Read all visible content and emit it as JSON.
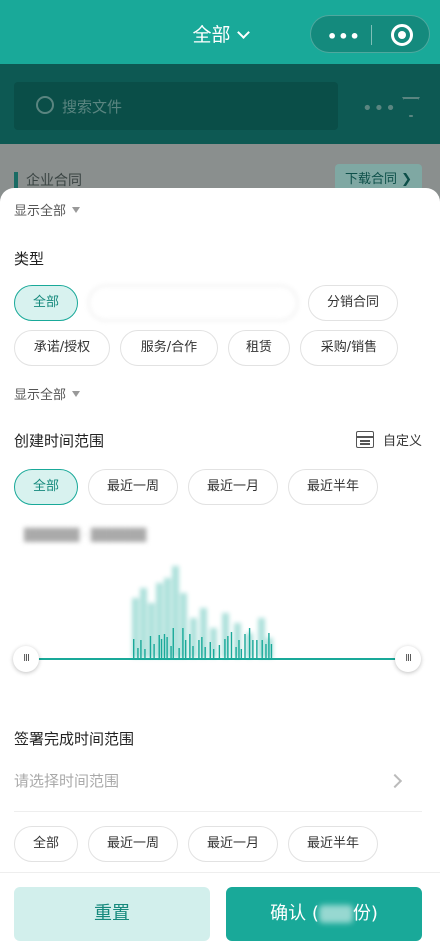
{
  "header": {
    "title": "全部",
    "more_icon": "more-dots-icon",
    "close_icon": "record-target-icon"
  },
  "background": {
    "search_placeholder": "搜索文件",
    "list_label": "企业合同",
    "download_label": "下载合同 ❯"
  },
  "filter": {
    "show_all_label": "显示全部",
    "type_title": "类型",
    "type_chips": [
      {
        "label": "全部",
        "active": true
      },
      {
        "label": "",
        "active": false
      },
      {
        "label": "分销合同",
        "active": false
      },
      {
        "label": "承诺/授权",
        "active": false
      },
      {
        "label": "服务/合作",
        "active": false
      },
      {
        "label": "租赁",
        "active": false
      },
      {
        "label": "采购/销售",
        "active": false
      }
    ],
    "create_time_title": "创建时间范围",
    "custom_label": "自定义",
    "time_chips": [
      "全部",
      "最近一周",
      "最近一月",
      "最近半年"
    ],
    "handle_glyph": "III",
    "sign_time_title": "签署完成时间范围",
    "sign_time_placeholder": "请选择时间范围",
    "sign_time_chips": [
      "全部",
      "最近一周",
      "最近一月",
      "最近半年"
    ]
  },
  "footer": {
    "reset_label": "重置",
    "confirm_prefix": "确认 (",
    "confirm_suffix": "份)"
  },
  "colors": {
    "primary": "#19a999",
    "primary_light": "#d8f2ef",
    "primary_text": "#15897c"
  }
}
